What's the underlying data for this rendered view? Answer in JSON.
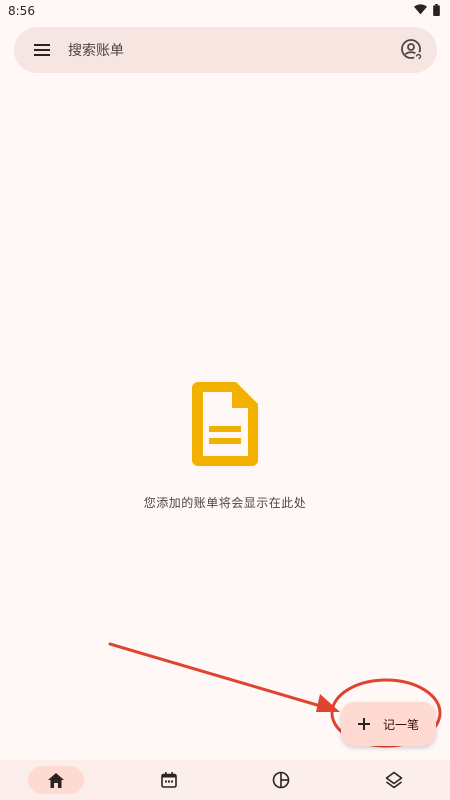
{
  "status_bar": {
    "time": "8:56",
    "icons": [
      "wifi-icon",
      "battery-icon"
    ]
  },
  "search": {
    "placeholder": "搜索账单",
    "menu_icon": "menu-icon",
    "account_icon": "account-sync-icon"
  },
  "empty_state": {
    "icon": "document-icon",
    "icon_color": "#f2b000",
    "message": "您添加的账单将会显示在此处"
  },
  "fab": {
    "icon": "plus-icon",
    "label": "记一笔"
  },
  "bottom_nav": {
    "items": [
      {
        "icon": "home-icon",
        "active": true
      },
      {
        "icon": "calendar-icon",
        "active": false
      },
      {
        "icon": "chart-pie-icon",
        "active": false
      },
      {
        "icon": "layers-icon",
        "active": false
      }
    ]
  },
  "colors": {
    "background": "#fff8f6",
    "search_bar": "#f7e5e2",
    "fab": "#ffdad3",
    "nav_active": "#ffdad3",
    "annotation": "#e0432e"
  }
}
